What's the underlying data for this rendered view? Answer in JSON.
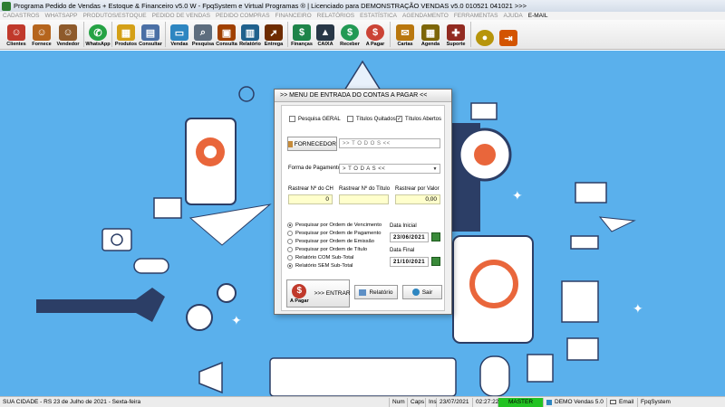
{
  "window": {
    "title": "Programa Pedido de Vendas + Estoque & Financeiro v5.0 W - FpqSystem e Virtual Programas ® | Licenciado para  DEMONSTRAÇÃO VENDAS v5.0 010521 041021 >>>"
  },
  "menu": [
    "CADASTROS",
    "WHATSAPP",
    "PRODUTOS/ESTOQUE",
    "PEDIDO DE VENDAS",
    "PEDIDO COMPRAS",
    "FINANCEIRO",
    "RELATÓRIOS",
    "ESTATÍSTICA",
    "AGENDAMENTO",
    "FERRAMENTAS",
    "AJUDA",
    "E-MAIL"
  ],
  "toolbar": [
    {
      "label": "Clientes",
      "icon": "clients-icon",
      "color": "#c0392b"
    },
    {
      "label": "Fornece",
      "icon": "supplier-icon",
      "color": "#b5651d"
    },
    {
      "label": "Vendedor",
      "icon": "seller-icon",
      "color": "#8e5a2b"
    },
    {
      "label": "WhatsApp",
      "icon": "whatsapp-icon",
      "color": "#25a244"
    },
    {
      "label": "Produtos",
      "icon": "products-icon",
      "color": "#d4a017"
    },
    {
      "label": "Consultar",
      "icon": "consult-icon",
      "color": "#4a6fa5"
    },
    {
      "label": "Vendas",
      "icon": "sales-icon",
      "color": "#2e86c1"
    },
    {
      "label": "Pesquisa",
      "icon": "search-icon",
      "color": "#5d6d7e"
    },
    {
      "label": "Consulta",
      "icon": "query-icon",
      "color": "#a04000"
    },
    {
      "label": "Relatório",
      "icon": "report-icon",
      "color": "#1f618d"
    },
    {
      "label": "Entrega",
      "icon": "delivery-icon",
      "color": "#6e2c00"
    },
    {
      "label": "Finanças",
      "icon": "finance-icon",
      "color": "#1e8449"
    },
    {
      "label": "CAIXA",
      "icon": "cashier-icon",
      "color": "#283747"
    },
    {
      "label": "Receber",
      "icon": "receive-icon",
      "color": "#229954"
    },
    {
      "label": "A Pagar",
      "icon": "pay-icon",
      "color": "#cb4335"
    },
    {
      "label": "Cartas",
      "icon": "letters-icon",
      "color": "#b9770e"
    },
    {
      "label": "Agenda",
      "icon": "calendar-icon",
      "color": "#7d6608"
    },
    {
      "label": "Suporte",
      "icon": "support-icon",
      "color": "#922b21"
    },
    {
      "label": "",
      "icon": "coin-icon",
      "color": "#b7950b"
    },
    {
      "label": "",
      "icon": "exit-icon",
      "color": "#d35400"
    }
  ],
  "dialog": {
    "title": ">>  MENU DE ENTRADA DO CONTAS A PAGAR  <<",
    "checkboxes": [
      {
        "label": "Pesquisa GERAL",
        "checked": false
      },
      {
        "label": "Títulos Quitados",
        "checked": false
      },
      {
        "label": "Títulos Abertos",
        "checked": true
      }
    ],
    "supplier_button": "FORNECEDOR",
    "supplier_value": ">> T O D O S <<",
    "payment_label": "Forma de Pagamento",
    "payment_value": "> T O D A S <<",
    "track_labels": [
      "Rastrear Nº do CH",
      "Rastrear Nº do Título",
      "Rastrear por Valor"
    ],
    "track_values": [
      "0",
      "",
      "0,00"
    ],
    "radios": [
      {
        "label": "Pesquisar por Ordem de Vencimento",
        "selected": true
      },
      {
        "label": "Pesquisar por Ordem de Pagamento",
        "selected": false
      },
      {
        "label": "Pesquisar por Ordem de Emissão",
        "selected": false
      },
      {
        "label": "Pesquisar por Ordem de Título",
        "selected": false
      },
      {
        "label": "Relatório COM Sub-Total",
        "selected": false
      },
      {
        "label": "Relatório SEM Sub-Total",
        "selected": true
      }
    ],
    "date_start_label": "Data Inicial",
    "date_start": "23/06/2021",
    "date_end_label": "Data Final",
    "date_end": "21/10/2021",
    "pay_badge": "A Pagar",
    "enter_button": ">>> ENTRAR",
    "report_button": "Relatório",
    "exit_button": "Sair"
  },
  "status": {
    "city": "SUA CIDADE - RS 23 de Julho de 2021 - Sexta-feira",
    "num": "Num",
    "caps": "Caps",
    "ins": "Ins",
    "date": "23/07/2021",
    "time": "02:27:22",
    "master": "MASTER",
    "demo": "DEMO Vendas 5.0",
    "email": "Email",
    "brand": "FpqSystem"
  }
}
